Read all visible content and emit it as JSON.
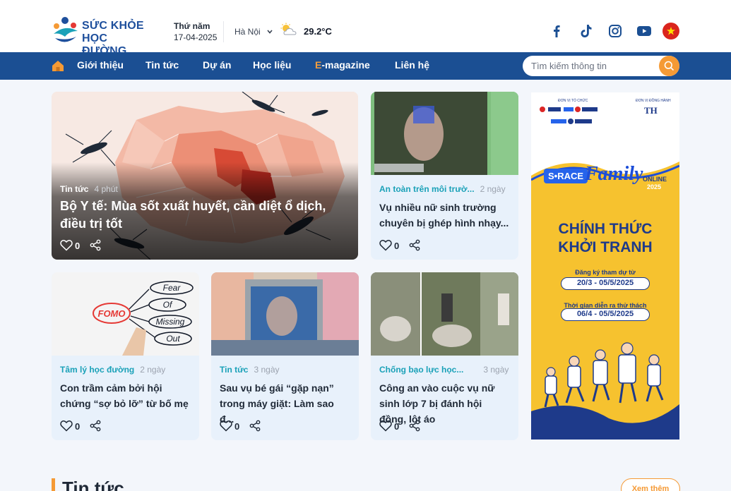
{
  "header": {
    "logo_line1": "SỨC KHỎE",
    "logo_line2": "HỌC ĐƯỜNG",
    "weekday": "Thứ năm",
    "date": "17-04-2025",
    "city": "Hà Nội",
    "temperature": "29.2°C",
    "weather_icon": "partly-cloudy-icon",
    "social": [
      "facebook-icon",
      "tiktok-icon",
      "instagram-icon",
      "youtube-icon",
      "vietnam-flag-icon"
    ]
  },
  "nav": {
    "items": [
      "Giới thiệu",
      "Tin tức",
      "Dự án",
      "Học liệu"
    ],
    "emag_prefix": "E",
    "emag_rest": "-magazine",
    "contact": "Liên hệ",
    "search_placeholder": "Tìm kiếm thông tin"
  },
  "hero": {
    "category": "Tin tức",
    "time": "4 phút",
    "title": "Bộ Y tế: Mùa sốt xuất huyết, cần diệt ổ dịch, điều trị tốt",
    "likes": "0"
  },
  "cards": [
    {
      "category": "An toàn trên môi trườ...",
      "time": "2 ngày",
      "title": "Vụ nhiều nữ sinh trường chuyên bị ghép hình nhạy...",
      "likes": "0"
    },
    {
      "category": "Tâm lý học đường",
      "time": "2 ngày",
      "title": "Con trầm cảm bởi hội chứng “sợ bỏ lỡ” từ bố mẹ",
      "likes": "0"
    },
    {
      "category": "Tin tức",
      "time": "3 ngày",
      "title": "Sau vụ bé gái “gặp nạn” trong máy giặt: Làm sao đ...",
      "likes": "0"
    },
    {
      "category": "Chống bạo lực học...",
      "time": "3 ngày",
      "title": "Công an vào cuộc vụ nữ sinh lớp 7 bị đánh hội đồng, lột áo",
      "likes": "0"
    }
  ],
  "fomo_words": [
    "FOMO",
    "Fear",
    "Of",
    "Missing",
    "Out"
  ],
  "ad": {
    "sponsor_left": "ĐƠN VỊ TỔ CHỨC",
    "sponsor_right": "ĐƠN VỊ ĐỒNG HÀNH",
    "th": "TH",
    "brand": "S•RACE",
    "family": "Family",
    "online": "ONLINE",
    "year": "2025",
    "headline1": "CHÍNH THỨC",
    "headline2": "KHỞI TRANH",
    "register_label": "Đăng ký tham dự từ",
    "register_dates": "20/3 - 05/5/2025",
    "challenge_label": "Thời gian diễn ra thử thách",
    "challenge_dates": "06/4 - 05/5/2025"
  },
  "section": {
    "title": "Tin tức",
    "see_more": "Xem thêm"
  },
  "colors": {
    "nav_bg": "#1b4f93",
    "accent": "#f59a35",
    "category": "#1aa1b8",
    "card_bg": "#e8f1fb"
  }
}
